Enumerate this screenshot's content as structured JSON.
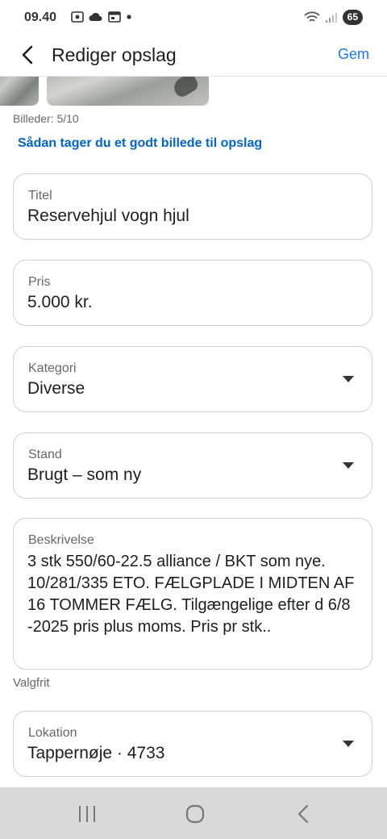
{
  "status_bar": {
    "time": "09.40",
    "battery": "65"
  },
  "header": {
    "title": "Rediger opslag",
    "save_label": "Gem"
  },
  "photos": {
    "count_text": "Billeder: 5/10",
    "tip_link": "Sådan tager du et godt billede til opslag"
  },
  "fields": {
    "title": {
      "label": "Titel",
      "value": "Reservehjul vogn hjul"
    },
    "price": {
      "label": "Pris",
      "value": "5.000 kr."
    },
    "category": {
      "label": "Kategori",
      "value": "Diverse"
    },
    "condition": {
      "label": "Stand",
      "value": "Brugt – som ny"
    },
    "description": {
      "label": "Beskrivelse",
      "value": "3 stk 550/60-22.5 alliance / BKT som nye. 10/281/335 ETO. FÆLGPLADE I MIDTEN AF 16 TOMMER FÆLG. Tilgængelige efter d 6/8 -2025 pris plus moms. Pris pr stk.."
    },
    "description_hint": "Valgfrit",
    "location": {
      "label": "Lokation",
      "value": "Tappernøje · 4733"
    }
  },
  "colors": {
    "accent": "#1877f2",
    "link": "#0064d1",
    "border": "#ced0d4",
    "nav_bar": "#d9d9d9"
  },
  "icons": [
    "back-arrow-icon",
    "dropdown-caret-icon",
    "recent-apps-icon",
    "home-icon",
    "nav-back-icon"
  ]
}
